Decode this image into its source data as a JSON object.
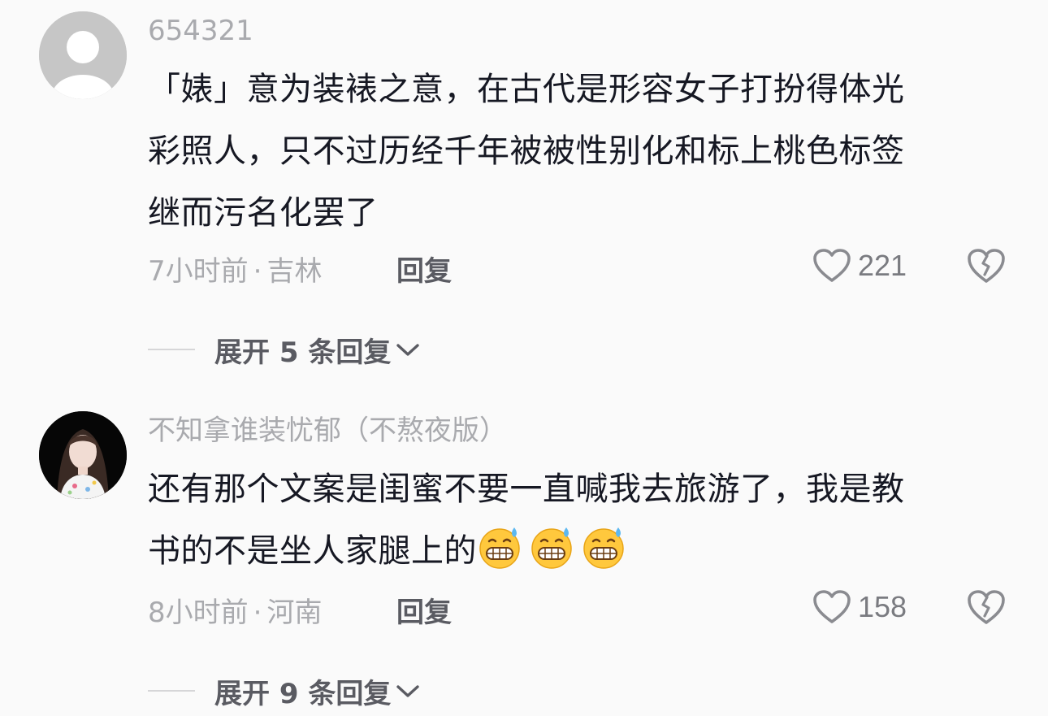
{
  "comments": [
    {
      "username": "654321",
      "lines": [
        "「婊」意为装裱之意，在古代是形容女子打扮得体光",
        "彩照人，只不过历经千年被被性别化和标上桃色标签",
        "继而污名化罢了"
      ],
      "time": "7小时前",
      "location": "吉林",
      "reply_label": "回复",
      "like_count": "221",
      "expand_label": "展开 5 条回复"
    },
    {
      "username": "不知拿谁装忧郁（不熬夜版）",
      "lines": [
        "还有那个文案是闺蜜不要一直喊我去旅游了，我是教",
        "书的不是坐人家腿上的"
      ],
      "emojis": [
        "grimacing-sweat-emoji",
        "grimacing-sweat-emoji",
        "grimacing-sweat-emoji"
      ],
      "time": "8小时前",
      "location": "河南",
      "reply_label": "回复",
      "like_count": "158",
      "expand_label": "展开 9 条回复"
    }
  ],
  "separator": "·",
  "icons": {
    "like": "heart-outline-icon",
    "dislike": "broken-heart-icon",
    "expand": "chevron-down-icon"
  },
  "colors": {
    "background": "#fafafa",
    "text_primary": "#161823",
    "text_secondary": "#a9aaae",
    "text_action": "#5a5b62"
  }
}
